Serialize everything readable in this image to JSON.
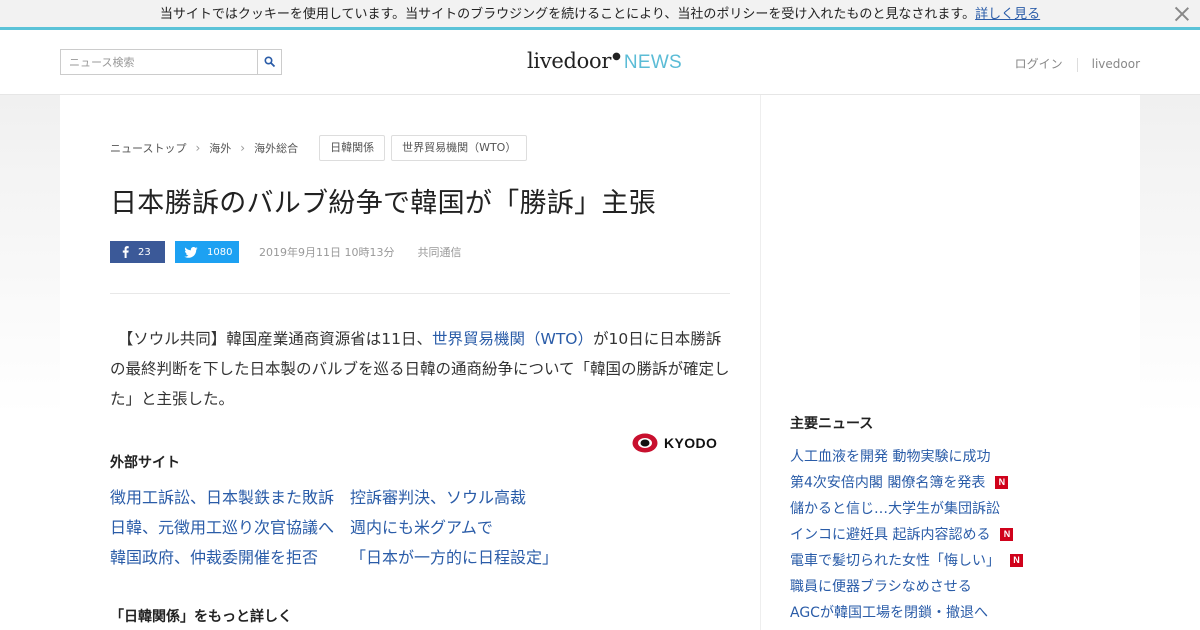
{
  "cookie_bar": {
    "message": "当サイトではクッキーを使用しています。当サイトのブラウジングを続けることにより、当社のポリシーを受け入れたものと見なされます。",
    "link_label": "詳しく見る"
  },
  "header": {
    "search": {
      "placeholder": "ニュース検索",
      "value": ""
    },
    "logo": {
      "main": "livedoor",
      "sub": "NEWS"
    },
    "links": [
      "ログイン",
      "livedoor"
    ]
  },
  "breadcrumb": {
    "items": [
      "ニューストップ",
      "海外",
      "海外総合"
    ],
    "tags": [
      "日韓関係",
      "世界貿易機関（WTO）"
    ]
  },
  "article": {
    "title": "日本勝訴のバルブ紛争で韓国が「勝訴」主張",
    "facebook_count": "23",
    "twitter_count": "1080",
    "date": "2019年9月11日 10時13分",
    "source": "共同通信",
    "body": {
      "before_link": "【ソウル共同】韓国産業通商資源省は11日、",
      "link": "世界貿易機関（WTO）",
      "after_link": "が10日に日本勝訴の最終判断を下した日本製のバルブを巡る日韓の通商紛争について「韓国の勝訴が確定した」と主張した。"
    },
    "credit_logo": "KYODO"
  },
  "external": {
    "heading": "外部サイト",
    "links": [
      [
        "徴用工訴訟、日本製鉄また敗訴",
        "控訴審判決、ソウル高裁"
      ],
      [
        "日韓、元徴用工巡り次官協議へ",
        "週内にも米グアムで"
      ],
      [
        "韓国政府、仲裁委開催を拒否",
        "「日本が一方的に日程設定」"
      ]
    ]
  },
  "more": {
    "heading": "「日韓関係」をもっと詳しく"
  },
  "sidebar": {
    "heading": "主要ニュース",
    "new_badge": "N",
    "items": [
      {
        "label": "人工血液を開発 動物実験に成功",
        "is_new": false
      },
      {
        "label": "第4次安倍内閣 閣僚名簿を発表",
        "is_new": true
      },
      {
        "label": "儲かると信じ…大学生が集団訴訟",
        "is_new": false
      },
      {
        "label": "インコに避妊具 起訴内容認める",
        "is_new": true
      },
      {
        "label": "電車で髪切られた女性「悔しい」",
        "is_new": true
      },
      {
        "label": "職員に便器ブラシなめさせる",
        "is_new": false
      },
      {
        "label": "AGCが韓国工場を閉鎖・撤退へ",
        "is_new": false
      }
    ]
  },
  "colors": {
    "accent": "#5bc3d8",
    "link": "#2a5ca8",
    "facebook": "#3b5998",
    "twitter": "#1da1f2",
    "new_badge": "#d0021b"
  }
}
